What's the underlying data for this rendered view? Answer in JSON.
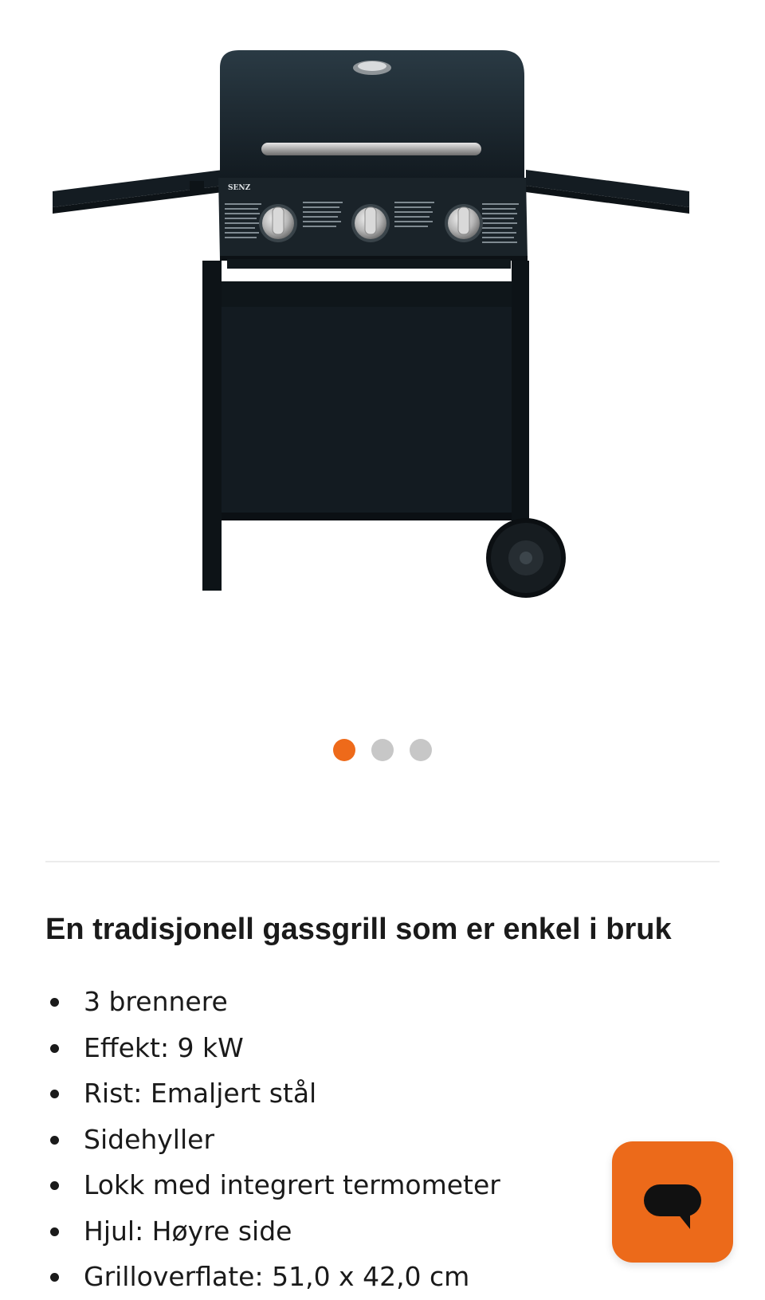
{
  "product": {
    "image_alt": "gas-grill-photo",
    "brand_plate": "SENZ"
  },
  "carousel": {
    "total": 3,
    "active_index": 0,
    "active_color": "#ee6a1a",
    "inactive_color": "#c7c7c7"
  },
  "description": {
    "heading": "En tradisjonell gassgrill som er enkel i bruk",
    "features": [
      "3 brennere",
      "Effekt: 9 kW",
      "Rist: Emaljert stål",
      "Sidehyller",
      "Lokk med integrert termometer",
      "Hjul: Høyre side",
      "Grilloverflate: 51,0 x 42,0 cm"
    ]
  },
  "chat": {
    "icon": "chat-bubble-icon",
    "color": "#ec6a1a"
  }
}
